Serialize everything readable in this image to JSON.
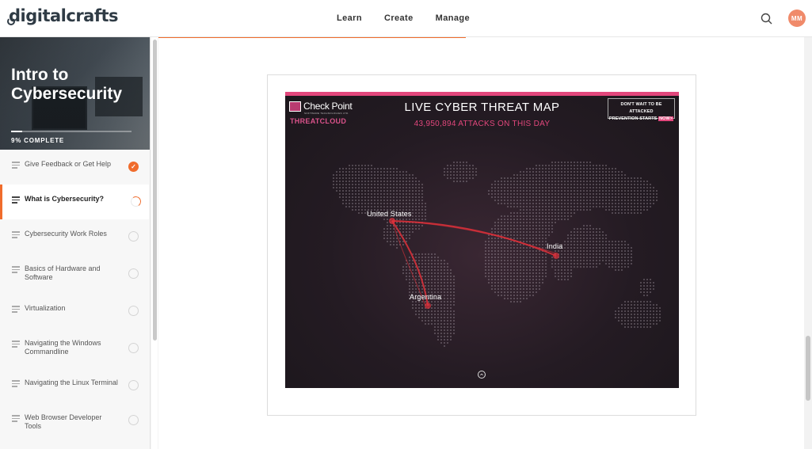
{
  "header": {
    "logo_text": "digitalcrafts",
    "nav": [
      "Learn",
      "Create",
      "Manage"
    ],
    "avatar_initials": "MM"
  },
  "course": {
    "title": "Intro to Cybersecurity",
    "progress_fraction": 0.09,
    "progress_label": "9% COMPLETE"
  },
  "lessons": [
    {
      "label": "Give Feedback or Get Help",
      "status": "complete"
    },
    {
      "label": "What is Cybersecurity?",
      "status": "in-progress"
    },
    {
      "label": "Cybersecurity Work Roles",
      "status": "not-started"
    },
    {
      "label": "Basics of Hardware and Software",
      "status": "not-started"
    },
    {
      "label": "Virtualization",
      "status": "not-started"
    },
    {
      "label": "Navigating the Windows Commandline",
      "status": "not-started"
    },
    {
      "label": "Navigating the Linux Terminal",
      "status": "not-started"
    },
    {
      "label": "Web Browser Developer Tools",
      "status": "not-started"
    }
  ],
  "threat_map": {
    "brand": "Check Point",
    "brand_sub": "SOFTWARE TECHNOLOGIES LTD.",
    "threatcloud": "THREATCLOUD",
    "title": "LIVE CYBER THREAT MAP",
    "attacks": "43,950,894 ATTACKS ON THIS DAY",
    "promo_line1": "DON'T WAIT TO BE ATTACKED",
    "promo_line2": "PREVENTION STARTS",
    "promo_now": "NOW>",
    "places": {
      "us": "United States",
      "india": "India",
      "argentina": "Argentina"
    }
  },
  "colors": {
    "accent": "#f06c2c",
    "threat_pink": "#e2477c",
    "avatar": "#f08a6a"
  }
}
